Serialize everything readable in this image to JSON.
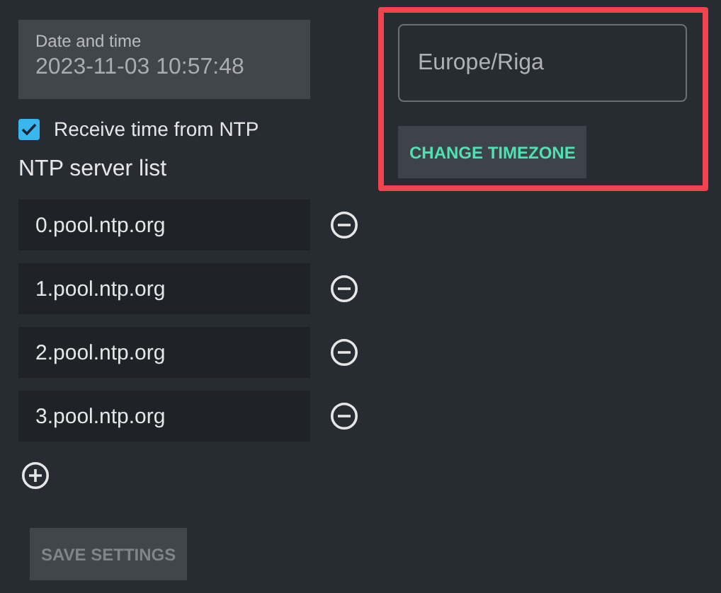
{
  "date_time": {
    "label": "Date and time",
    "value": "2023-11-03 10:57:48"
  },
  "ntp_checkbox": {
    "label": "Receive time from NTP",
    "checked": true
  },
  "ntp_list": {
    "title": "NTP server list",
    "servers": [
      {
        "value": "0.pool.ntp.org"
      },
      {
        "value": "1.pool.ntp.org"
      },
      {
        "value": "2.pool.ntp.org"
      },
      {
        "value": "3.pool.ntp.org"
      }
    ]
  },
  "save_button": {
    "label": "SAVE SETTINGS",
    "disabled": true
  },
  "timezone": {
    "value": "Europe/Riga",
    "button": "CHANGE TIMEZONE",
    "highlighted": true
  }
}
